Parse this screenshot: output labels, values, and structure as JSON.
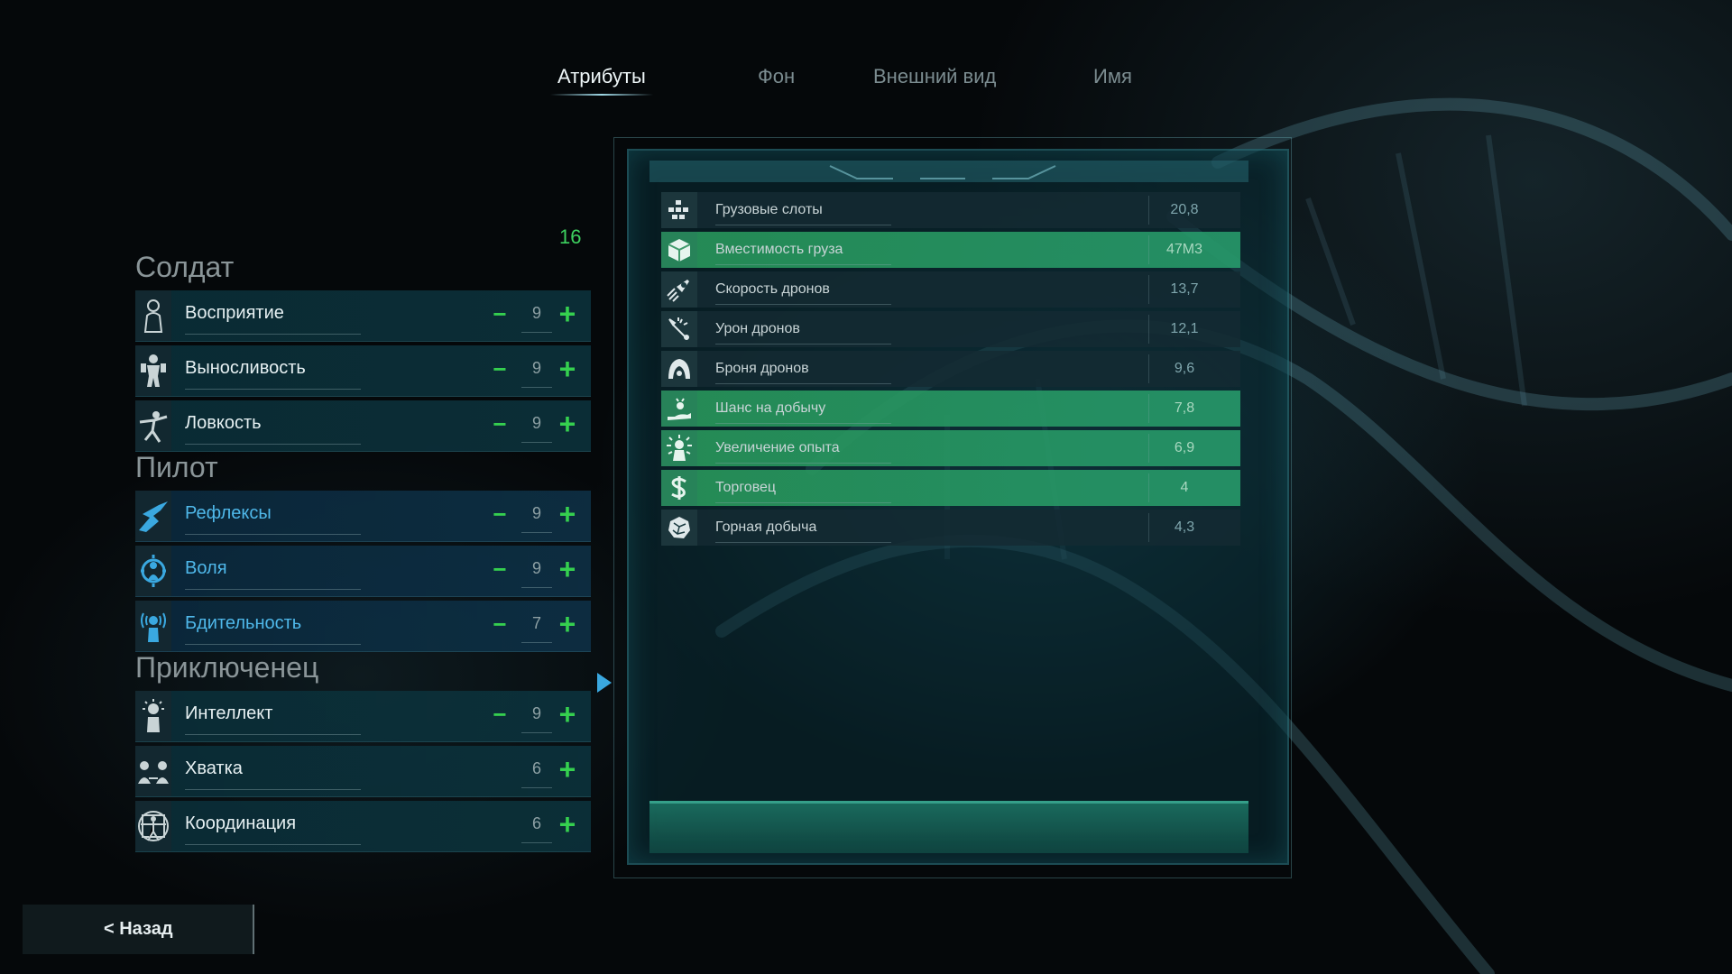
{
  "tabs": [
    {
      "label": "Атрибуты",
      "active": true
    },
    {
      "label": "Фон",
      "active": false
    },
    {
      "label": "Внешний вид",
      "active": false
    },
    {
      "label": "Имя",
      "active": false
    }
  ],
  "available_points": "16",
  "groups": [
    {
      "title": "Солдат",
      "attributes": [
        {
          "label": "Восприятие",
          "value": "9",
          "has_minus": true,
          "icon": "perception-icon"
        },
        {
          "label": "Выносливость",
          "value": "9",
          "has_minus": true,
          "icon": "endurance-icon"
        },
        {
          "label": "Ловкость",
          "value": "9",
          "has_minus": true,
          "icon": "agility-icon"
        }
      ]
    },
    {
      "title": "Пилот",
      "attributes": [
        {
          "label": "Рефлексы",
          "value": "9",
          "has_minus": true,
          "icon": "reflexes-icon"
        },
        {
          "label": "Воля",
          "value": "9",
          "has_minus": true,
          "icon": "willpower-icon"
        },
        {
          "label": "Бдительность",
          "value": "7",
          "has_minus": true,
          "icon": "vigilance-icon"
        }
      ]
    },
    {
      "title": "Приключенец",
      "attributes": [
        {
          "label": "Интеллект",
          "value": "9",
          "has_minus": true,
          "icon": "intellect-icon"
        },
        {
          "label": "Хватка",
          "value": "6",
          "has_minus": false,
          "icon": "grip-icon"
        },
        {
          "label": "Координация",
          "value": "6",
          "has_minus": false,
          "icon": "coordination-icon"
        }
      ]
    }
  ],
  "buttons": {
    "minus": "−",
    "plus": "+"
  },
  "stats": [
    {
      "label": "Грузовые слоты",
      "value": "20,8",
      "highlight": false,
      "icon": "cargo-slots-icon"
    },
    {
      "label": "Вместимость груза",
      "value": "47М3",
      "highlight": true,
      "icon": "cargo-box-icon"
    },
    {
      "label": "Скорость дронов",
      "value": "13,7",
      "highlight": false,
      "icon": "drone-speed-icon"
    },
    {
      "label": "Урон дронов",
      "value": "12,1",
      "highlight": false,
      "icon": "drone-damage-icon"
    },
    {
      "label": "Броня дронов",
      "value": "9,6",
      "highlight": false,
      "icon": "drone-armor-icon"
    },
    {
      "label": "Шанс на добычу",
      "value": "7,8",
      "highlight": true,
      "icon": "loot-chance-icon"
    },
    {
      "label": "Увеличение опыта",
      "value": "6,9",
      "highlight": true,
      "icon": "xp-boost-icon"
    },
    {
      "label": "Торговец",
      "value": "4",
      "highlight": true,
      "icon": "dollar-icon"
    },
    {
      "label": "Горная добыча",
      "value": "4,3",
      "highlight": false,
      "icon": "mining-icon"
    }
  ],
  "back_button": "< Назад",
  "colors": {
    "accent_green": "#35d04f",
    "pilot_blue": "#4fb8ea",
    "highlight_row": "#2f9a60"
  }
}
